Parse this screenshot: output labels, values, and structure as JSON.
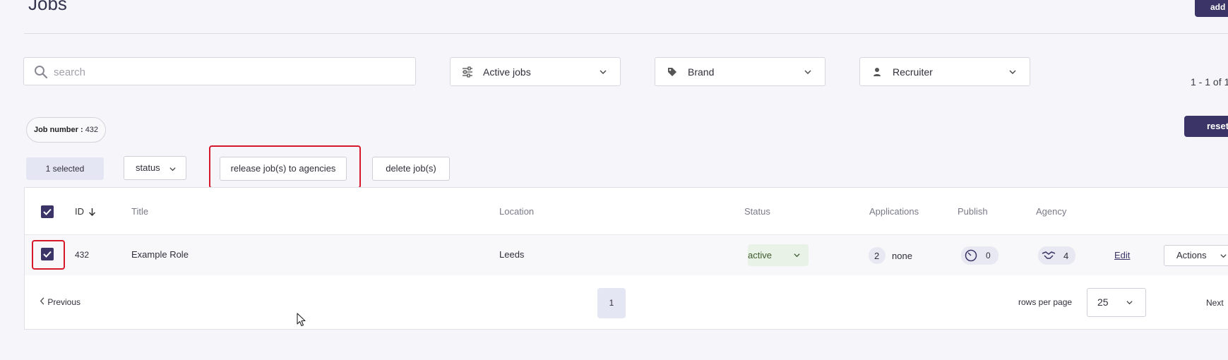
{
  "header": {
    "title": "Jobs",
    "add_label": "add"
  },
  "filters": {
    "search_placeholder": "search",
    "job_state": "Active jobs",
    "brand": "Brand",
    "recruiter": "Recruiter",
    "results_count": "1 - 1 of 1"
  },
  "active_filter": {
    "label": "Job number :",
    "value": "432"
  },
  "reset_label": "reset",
  "bulk": {
    "selected_label": "1 selected",
    "status_label": "status",
    "release_label": "release job(s) to agencies",
    "delete_label": "delete job(s)"
  },
  "table": {
    "columns": {
      "id": "ID",
      "title": "Title",
      "location": "Location",
      "status": "Status",
      "applications": "Applications",
      "publish": "Publish",
      "agency": "Agency"
    },
    "rows": [
      {
        "id": "432",
        "title": "Example Role",
        "location": "Leeds",
        "status": "active",
        "applications_count": "2",
        "applications_stage": "none",
        "publish_count": "0",
        "agency_count": "4",
        "edit_label": "Edit",
        "actions_label": "Actions",
        "checked": true
      }
    ]
  },
  "pagination": {
    "previous_label": "Previous",
    "current_page": "1",
    "rows_per_page_label": "rows per page",
    "rows_per_page_value": "25",
    "next_label": "Next"
  },
  "colors": {
    "primary": "#3b3466",
    "highlight": "#d6192a",
    "status_active_bg": "#e9f2e6"
  }
}
